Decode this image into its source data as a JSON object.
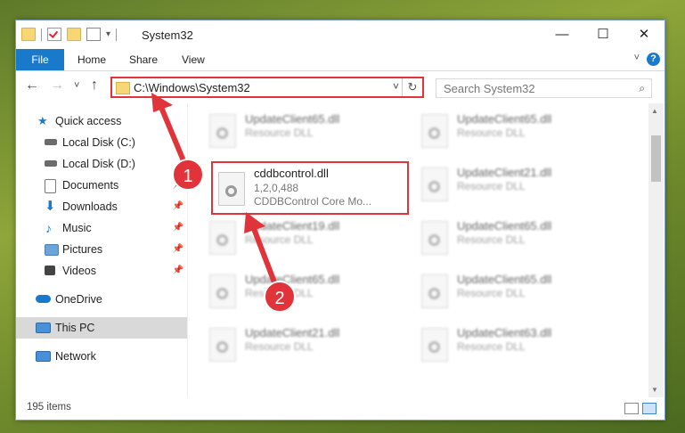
{
  "window": {
    "title": "System32",
    "min_glyph": "—",
    "max_glyph": "☐",
    "close_glyph": "✕"
  },
  "ribbon": {
    "file_label": "File",
    "tabs": [
      "Home",
      "Share",
      "View"
    ],
    "help_glyph": "?",
    "expand_glyph": "˅"
  },
  "nav": {
    "back": "←",
    "forward": "→",
    "recent": "˅",
    "up": "↑"
  },
  "address": {
    "path": "C:\\Windows\\System32",
    "dropdown": "˅",
    "refresh": "↻"
  },
  "search": {
    "placeholder": "Search System32",
    "icon": "⌕"
  },
  "sidebar": {
    "items": [
      {
        "label": "Quick access",
        "icon": "star-icon",
        "pinned": false
      },
      {
        "label": "Local Disk (C:)",
        "icon": "drive-icon",
        "pinned": false
      },
      {
        "label": "Local Disk (D:)",
        "icon": "drive-icon",
        "pinned": false
      },
      {
        "label": "Documents",
        "icon": "documents-icon",
        "pinned": true
      },
      {
        "label": "Downloads",
        "icon": "downloads-icon",
        "pinned": true
      },
      {
        "label": "Music",
        "icon": "music-icon",
        "pinned": true
      },
      {
        "label": "Pictures",
        "icon": "pictures-icon",
        "pinned": true
      },
      {
        "label": "Videos",
        "icon": "videos-icon",
        "pinned": true
      },
      {
        "label": "OneDrive",
        "icon": "onedrive-icon",
        "pinned": false
      },
      {
        "label": "This PC",
        "icon": "pc-icon",
        "pinned": false
      },
      {
        "label": "Network",
        "icon": "network-icon",
        "pinned": false
      }
    ],
    "pin_glyph": "📌"
  },
  "files": [
    {
      "name": "UpdateClient65.dll",
      "type": "Resource DLL"
    },
    {
      "name": "UpdateClient65.dll",
      "type": "Resource DLL"
    },
    {
      "name": "cddbcontrol.dll",
      "version": "1,2,0,488",
      "type": "CDDBControl Core Mo..."
    },
    {
      "name": "UpdateClient21.dll",
      "type": "Resource DLL"
    },
    {
      "name": "UpdateClient19.dll",
      "type": "Resource DLL"
    },
    {
      "name": "UpdateClient65.dll",
      "type": "Resource DLL"
    },
    {
      "name": "UpdateClient65.dll",
      "type": "Resource DLL"
    },
    {
      "name": "UpdateClient65.dll",
      "type": "Resource DLL"
    },
    {
      "name": "UpdateClient21.dll",
      "type": "Resource DLL"
    },
    {
      "name": "UpdateClient63.dll",
      "type": "Resource DLL"
    }
  ],
  "status": {
    "count": "195 items"
  },
  "markers": [
    "1",
    "2"
  ],
  "colors": {
    "accent": "#1979ca",
    "highlight": "#e0333a"
  }
}
